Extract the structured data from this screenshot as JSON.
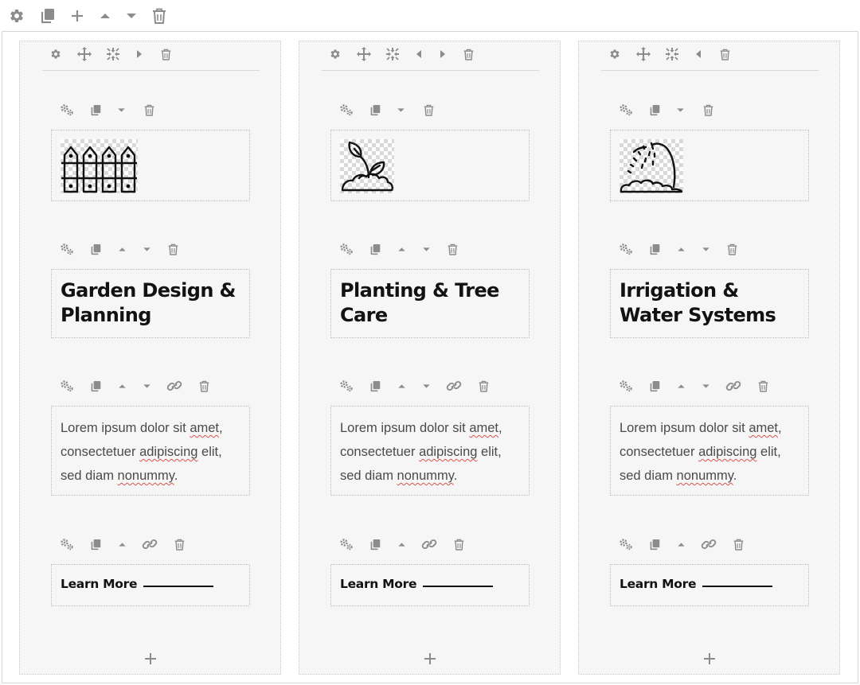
{
  "toolbar": {
    "icons": [
      "gear-icon",
      "copy-icon",
      "plus-icon",
      "caret-up-icon",
      "caret-down-icon",
      "trash-icon"
    ]
  },
  "columns": [
    {
      "tools": [
        "gear-icon",
        "move-icon",
        "resize-icon",
        "caret-right-icon",
        "trash-icon"
      ],
      "image_icon": "fence-icon",
      "heading": "Garden Design & Planning",
      "text_parts": [
        "Lorem ipsum dolor sit ",
        "amet",
        ", consectetuer ",
        "adipiscing",
        " elit, sed diam ",
        "nonummy",
        "."
      ],
      "button_label": "Learn More"
    },
    {
      "tools": [
        "gear-icon",
        "move-icon",
        "resize-icon",
        "caret-left-icon",
        "caret-right-icon",
        "trash-icon"
      ],
      "image_icon": "plant-sprout-icon",
      "heading": "Planting & Tree Care",
      "text_parts": [
        "Lorem ipsum dolor sit ",
        "amet",
        ", consectetuer ",
        "adipiscing",
        " elit, sed diam ",
        "nonummy",
        "."
      ],
      "button_label": "Learn More"
    },
    {
      "tools": [
        "gear-icon",
        "move-icon",
        "resize-icon",
        "caret-left-icon",
        "trash-icon"
      ],
      "image_icon": "sprinkler-icon",
      "heading": "Irrigation & Water Systems",
      "text_parts": [
        "Lorem ipsum dolor sit ",
        "amet",
        ", consectetuer ",
        "adipiscing",
        " elit, sed diam ",
        "nonummy",
        "."
      ],
      "button_label": "Learn More"
    }
  ],
  "colors": {
    "icon_gray": "#8c8c8c",
    "column_bg": "#f6f6f6",
    "heading": "#121212",
    "body_text": "#4a4a4a",
    "spellcheck_underline": "#d9534f"
  }
}
